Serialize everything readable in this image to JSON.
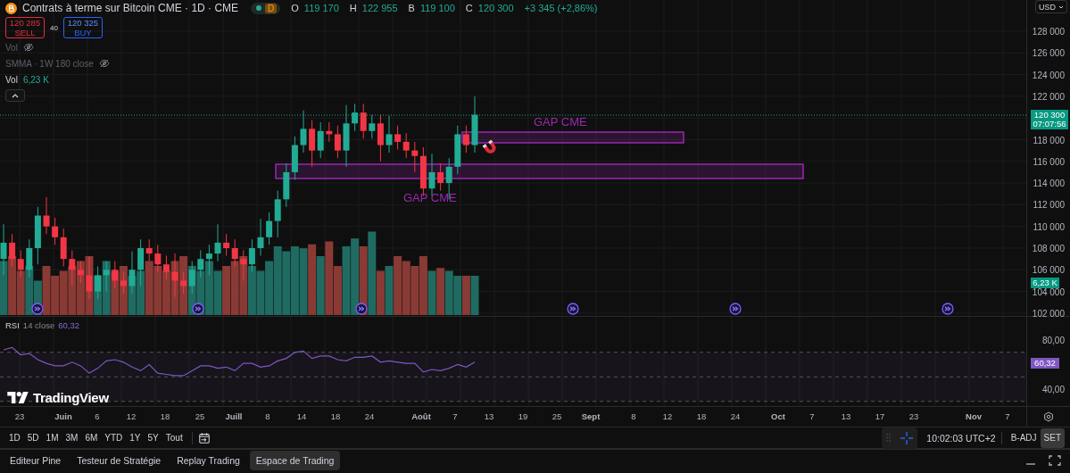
{
  "header": {
    "title": "Contrats à terme sur Bitcoin CME · 1D · CME",
    "status_badge": "D",
    "ohlc": [
      {
        "key": "O",
        "value": "119 170"
      },
      {
        "key": "H",
        "value": "122 955"
      },
      {
        "key": "B",
        "value": "119 100"
      },
      {
        "key": "C",
        "value": "120 300"
      }
    ],
    "change": "+3 345 (+2,86%)"
  },
  "trade": {
    "sell": {
      "price": "120 285",
      "label": "SELL"
    },
    "spread": "40",
    "buy": {
      "price": "120 325",
      "label": "BUY"
    }
  },
  "indicators": [
    {
      "label": "Vol",
      "visible": false
    },
    {
      "label": "SMMA · 1W 180 close",
      "visible": false
    },
    {
      "label": "Vol",
      "value": "6,23 K",
      "visible": true
    }
  ],
  "annotations": [
    {
      "label": "GAP CME"
    },
    {
      "label": "GAP CME"
    }
  ],
  "price_axis": {
    "currency": "USD",
    "ticks": [
      "128 000",
      "126 000",
      "124 000",
      "122 000",
      "118 000",
      "116 000",
      "114 000",
      "112 000",
      "110 000",
      "108 000",
      "106 000",
      "104 000",
      "102 000"
    ],
    "last_price": "120 300",
    "countdown": "07:07:56",
    "volume_tag": "6,23 K"
  },
  "rsi": {
    "name": "RSI",
    "params": "14 close",
    "value": "60,32",
    "ticks": [
      "80,00",
      "40,00"
    ],
    "value_tag": "60,32"
  },
  "logo": "TradingView",
  "time_axis": [
    {
      "label": "23",
      "kind": "day"
    },
    {
      "label": "Juin",
      "kind": "month"
    },
    {
      "label": "6",
      "kind": "day"
    },
    {
      "label": "12",
      "kind": "day"
    },
    {
      "label": "18",
      "kind": "day"
    },
    {
      "label": "25",
      "kind": "day"
    },
    {
      "label": "Juill",
      "kind": "month"
    },
    {
      "label": "8",
      "kind": "day"
    },
    {
      "label": "14",
      "kind": "day"
    },
    {
      "label": "18",
      "kind": "day"
    },
    {
      "label": "24",
      "kind": "day"
    },
    {
      "label": "Août",
      "kind": "month"
    },
    {
      "label": "7",
      "kind": "day"
    },
    {
      "label": "13",
      "kind": "day"
    },
    {
      "label": "19",
      "kind": "day"
    },
    {
      "label": "25",
      "kind": "day"
    },
    {
      "label": "Sept",
      "kind": "month"
    },
    {
      "label": "8",
      "kind": "day"
    },
    {
      "label": "12",
      "kind": "day"
    },
    {
      "label": "18",
      "kind": "day"
    },
    {
      "label": "24",
      "kind": "day"
    },
    {
      "label": "Oct",
      "kind": "month"
    },
    {
      "label": "7",
      "kind": "day"
    },
    {
      "label": "13",
      "kind": "day"
    },
    {
      "label": "17",
      "kind": "day"
    },
    {
      "label": "23",
      "kind": "day"
    },
    {
      "label": "Nov",
      "kind": "month"
    },
    {
      "label": "7",
      "kind": "day"
    }
  ],
  "ranges": [
    "1D",
    "5D",
    "1M",
    "3M",
    "6M",
    "YTD",
    "1Y",
    "5Y",
    "Tout"
  ],
  "status": {
    "clock": "10:02:03 UTC+2",
    "toggles": [
      {
        "label": "B-ADJ",
        "selected": false
      },
      {
        "label": "SET",
        "selected": true
      }
    ]
  },
  "bottom_tabs": [
    {
      "label": "Editeur Pine",
      "selected": false
    },
    {
      "label": "Testeur de Stratégie",
      "selected": false
    },
    {
      "label": "Replay Trading",
      "selected": false
    },
    {
      "label": "Espace de Trading",
      "selected": true
    }
  ]
}
